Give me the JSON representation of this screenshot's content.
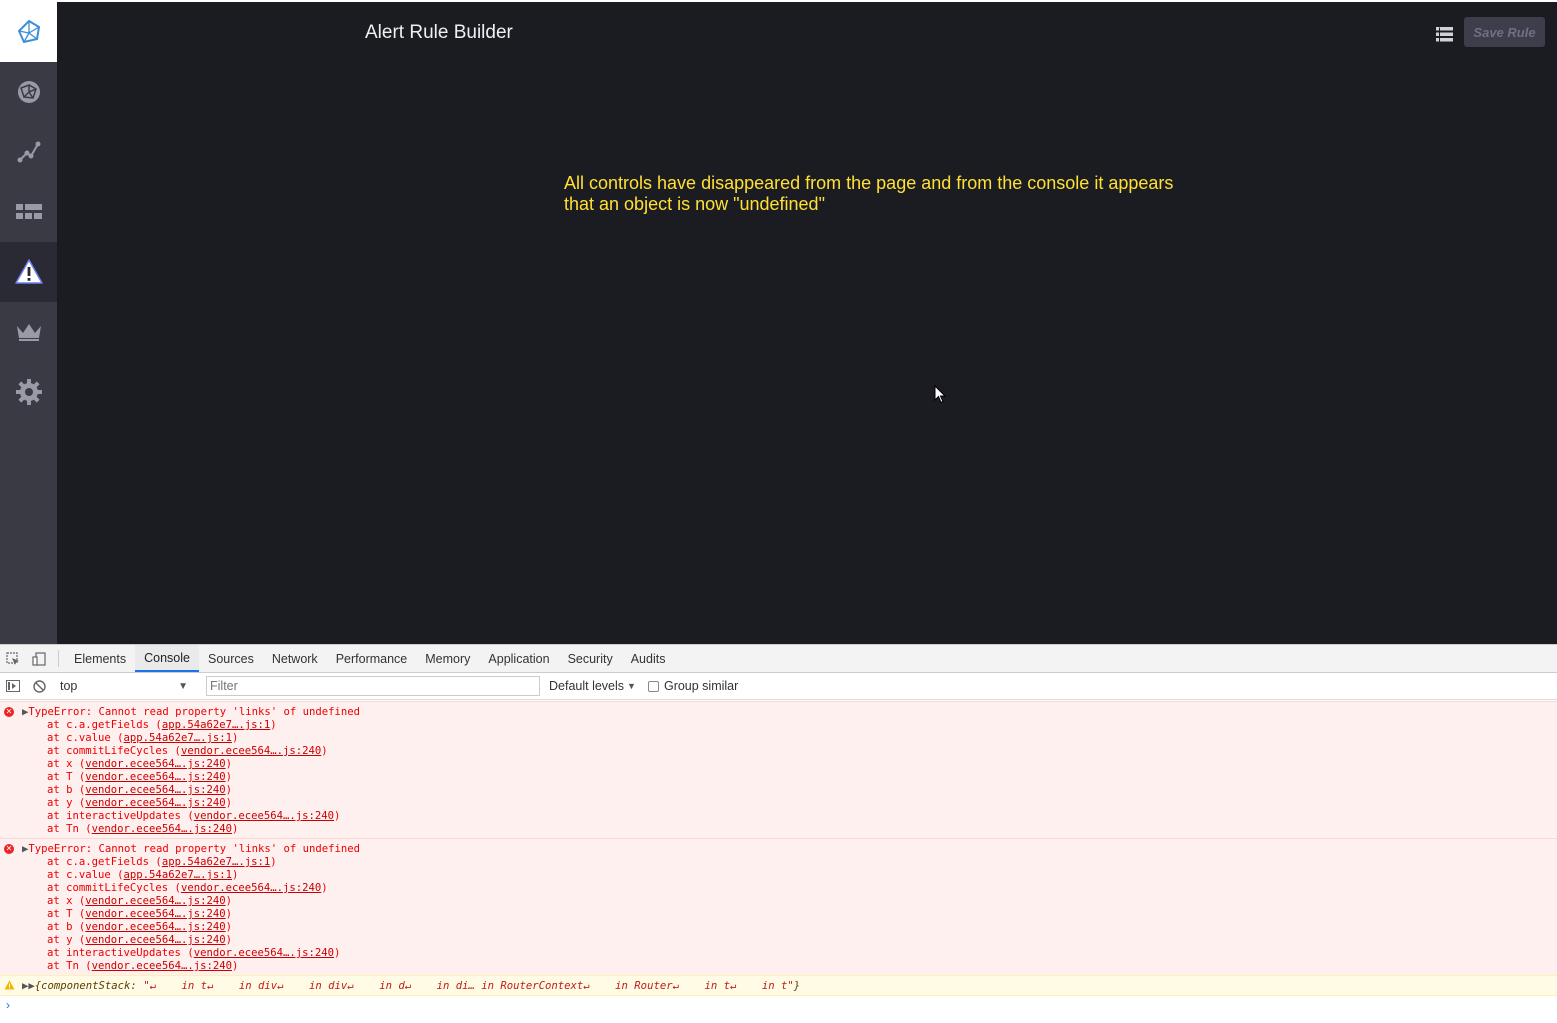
{
  "app": {
    "title": "Alert Rule Builder",
    "save_label": "Save Rule",
    "note": "All controls have disappeared from the page and from the console it appears that an object is now \"undefined\"",
    "sidebar": [
      {
        "icon": "logo-icon",
        "active": false
      },
      {
        "icon": "network-globe-icon",
        "active": false
      },
      {
        "icon": "graph-icon",
        "active": false
      },
      {
        "icon": "grid-table-icon",
        "active": false
      },
      {
        "icon": "alert-warning-icon",
        "active": true
      },
      {
        "icon": "crown-icon",
        "active": false
      },
      {
        "icon": "gear-icon",
        "active": false
      }
    ],
    "colors": {
      "background": "#1b1b22",
      "sidebar": "#3a3a45",
      "note": "#ffe033",
      "accent": "#3b8fd9"
    }
  },
  "devtools": {
    "tabs": [
      "Elements",
      "Console",
      "Sources",
      "Network",
      "Performance",
      "Memory",
      "Application",
      "Security",
      "Audits"
    ],
    "active_tab": "Console",
    "context": "top",
    "filter_placeholder": "Filter",
    "levels_label": "Default levels",
    "group_similar_label": "Group similar",
    "errors": [
      {
        "message": "TypeError: Cannot read property 'links' of undefined",
        "frames": [
          {
            "fn": "at c.a.getFields (",
            "src": "app.54a62e7….js:1",
            "end": ")"
          },
          {
            "fn": "at c.value (",
            "src": "app.54a62e7….js:1",
            "end": ")"
          },
          {
            "fn": "at commitLifeCycles (",
            "src": "vendor.ecee564….js:240",
            "end": ")"
          },
          {
            "fn": "at x (",
            "src": "vendor.ecee564….js:240",
            "end": ")"
          },
          {
            "fn": "at T (",
            "src": "vendor.ecee564….js:240",
            "end": ")"
          },
          {
            "fn": "at b (",
            "src": "vendor.ecee564….js:240",
            "end": ")"
          },
          {
            "fn": "at y (",
            "src": "vendor.ecee564….js:240",
            "end": ")"
          },
          {
            "fn": "at interactiveUpdates (",
            "src": "vendor.ecee564….js:240",
            "end": ")"
          },
          {
            "fn": "at Tn (",
            "src": "vendor.ecee564….js:240",
            "end": ")"
          }
        ]
      },
      {
        "message": "TypeError: Cannot read property 'links' of undefined",
        "frames": [
          {
            "fn": "at c.a.getFields (",
            "src": "app.54a62e7….js:1",
            "end": ")"
          },
          {
            "fn": "at c.value (",
            "src": "app.54a62e7….js:1",
            "end": ")"
          },
          {
            "fn": "at commitLifeCycles (",
            "src": "vendor.ecee564….js:240",
            "end": ")"
          },
          {
            "fn": "at x (",
            "src": "vendor.ecee564….js:240",
            "end": ")"
          },
          {
            "fn": "at T (",
            "src": "vendor.ecee564….js:240",
            "end": ")"
          },
          {
            "fn": "at b (",
            "src": "vendor.ecee564….js:240",
            "end": ")"
          },
          {
            "fn": "at y (",
            "src": "vendor.ecee564….js:240",
            "end": ")"
          },
          {
            "fn": "at interactiveUpdates (",
            "src": "vendor.ecee564….js:240",
            "end": ")"
          },
          {
            "fn": "at Tn (",
            "src": "vendor.ecee564….js:240",
            "end": ")"
          }
        ]
      }
    ],
    "warning": {
      "prefix": "{componentStack: ",
      "value": "\"↵    in t↵    in div↵    in div↵    in d↵    in di… in RouterContext↵    in Router↵    in t↵    in t\"",
      "suffix": "}"
    },
    "prompt": "›"
  }
}
